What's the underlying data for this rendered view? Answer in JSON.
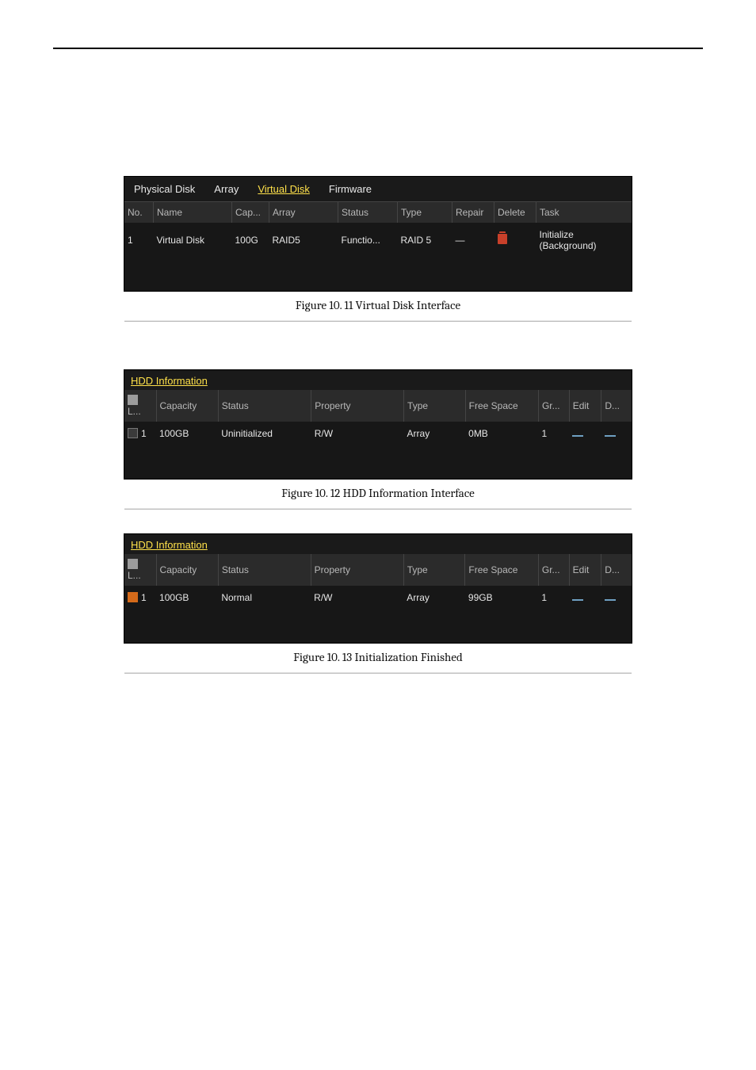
{
  "figure1": {
    "tabs": {
      "physical": "Physical Disk",
      "array": "Array",
      "virtual": "Virtual Disk",
      "firmware": "Firmware"
    },
    "headers": {
      "no": "No.",
      "name": "Name",
      "cap": "Cap...",
      "array": "Array",
      "status": "Status",
      "type": "Type",
      "repair": "Repair",
      "delete": "Delete",
      "task": "Task"
    },
    "row": {
      "no": "1",
      "name": "Virtual Disk",
      "cap": "100G",
      "array": "RAID5",
      "status": "Functio...",
      "type": "RAID 5",
      "repair": "—",
      "task": "Initialize (Background)"
    },
    "caption": "Figure 10. 11 Virtual Disk Interface"
  },
  "figure2": {
    "title": "HDD Information",
    "headers": {
      "l": "L...",
      "capacity": "Capacity",
      "status": "Status",
      "property": "Property",
      "type": "Type",
      "free": "Free Space",
      "gr": "Gr...",
      "edit": "Edit",
      "d": "D..."
    },
    "row": {
      "l": "1",
      "capacity": "100GB",
      "status": "Uninitialized",
      "property": "R/W",
      "type": "Array",
      "free": "0MB",
      "gr": "1"
    },
    "caption": "Figure 10. 12 HDD Information Interface"
  },
  "figure3": {
    "title": "HDD Information",
    "headers": {
      "l": "L...",
      "capacity": "Capacity",
      "status": "Status",
      "property": "Property",
      "type": "Type",
      "free": "Free Space",
      "gr": "Gr...",
      "edit": "Edit",
      "d": "D..."
    },
    "row": {
      "l": "1",
      "capacity": "100GB",
      "status": "Normal",
      "property": "R/W",
      "type": "Array",
      "free": "99GB",
      "gr": "1"
    },
    "caption": "Figure 10. 13 Initialization Finished"
  }
}
